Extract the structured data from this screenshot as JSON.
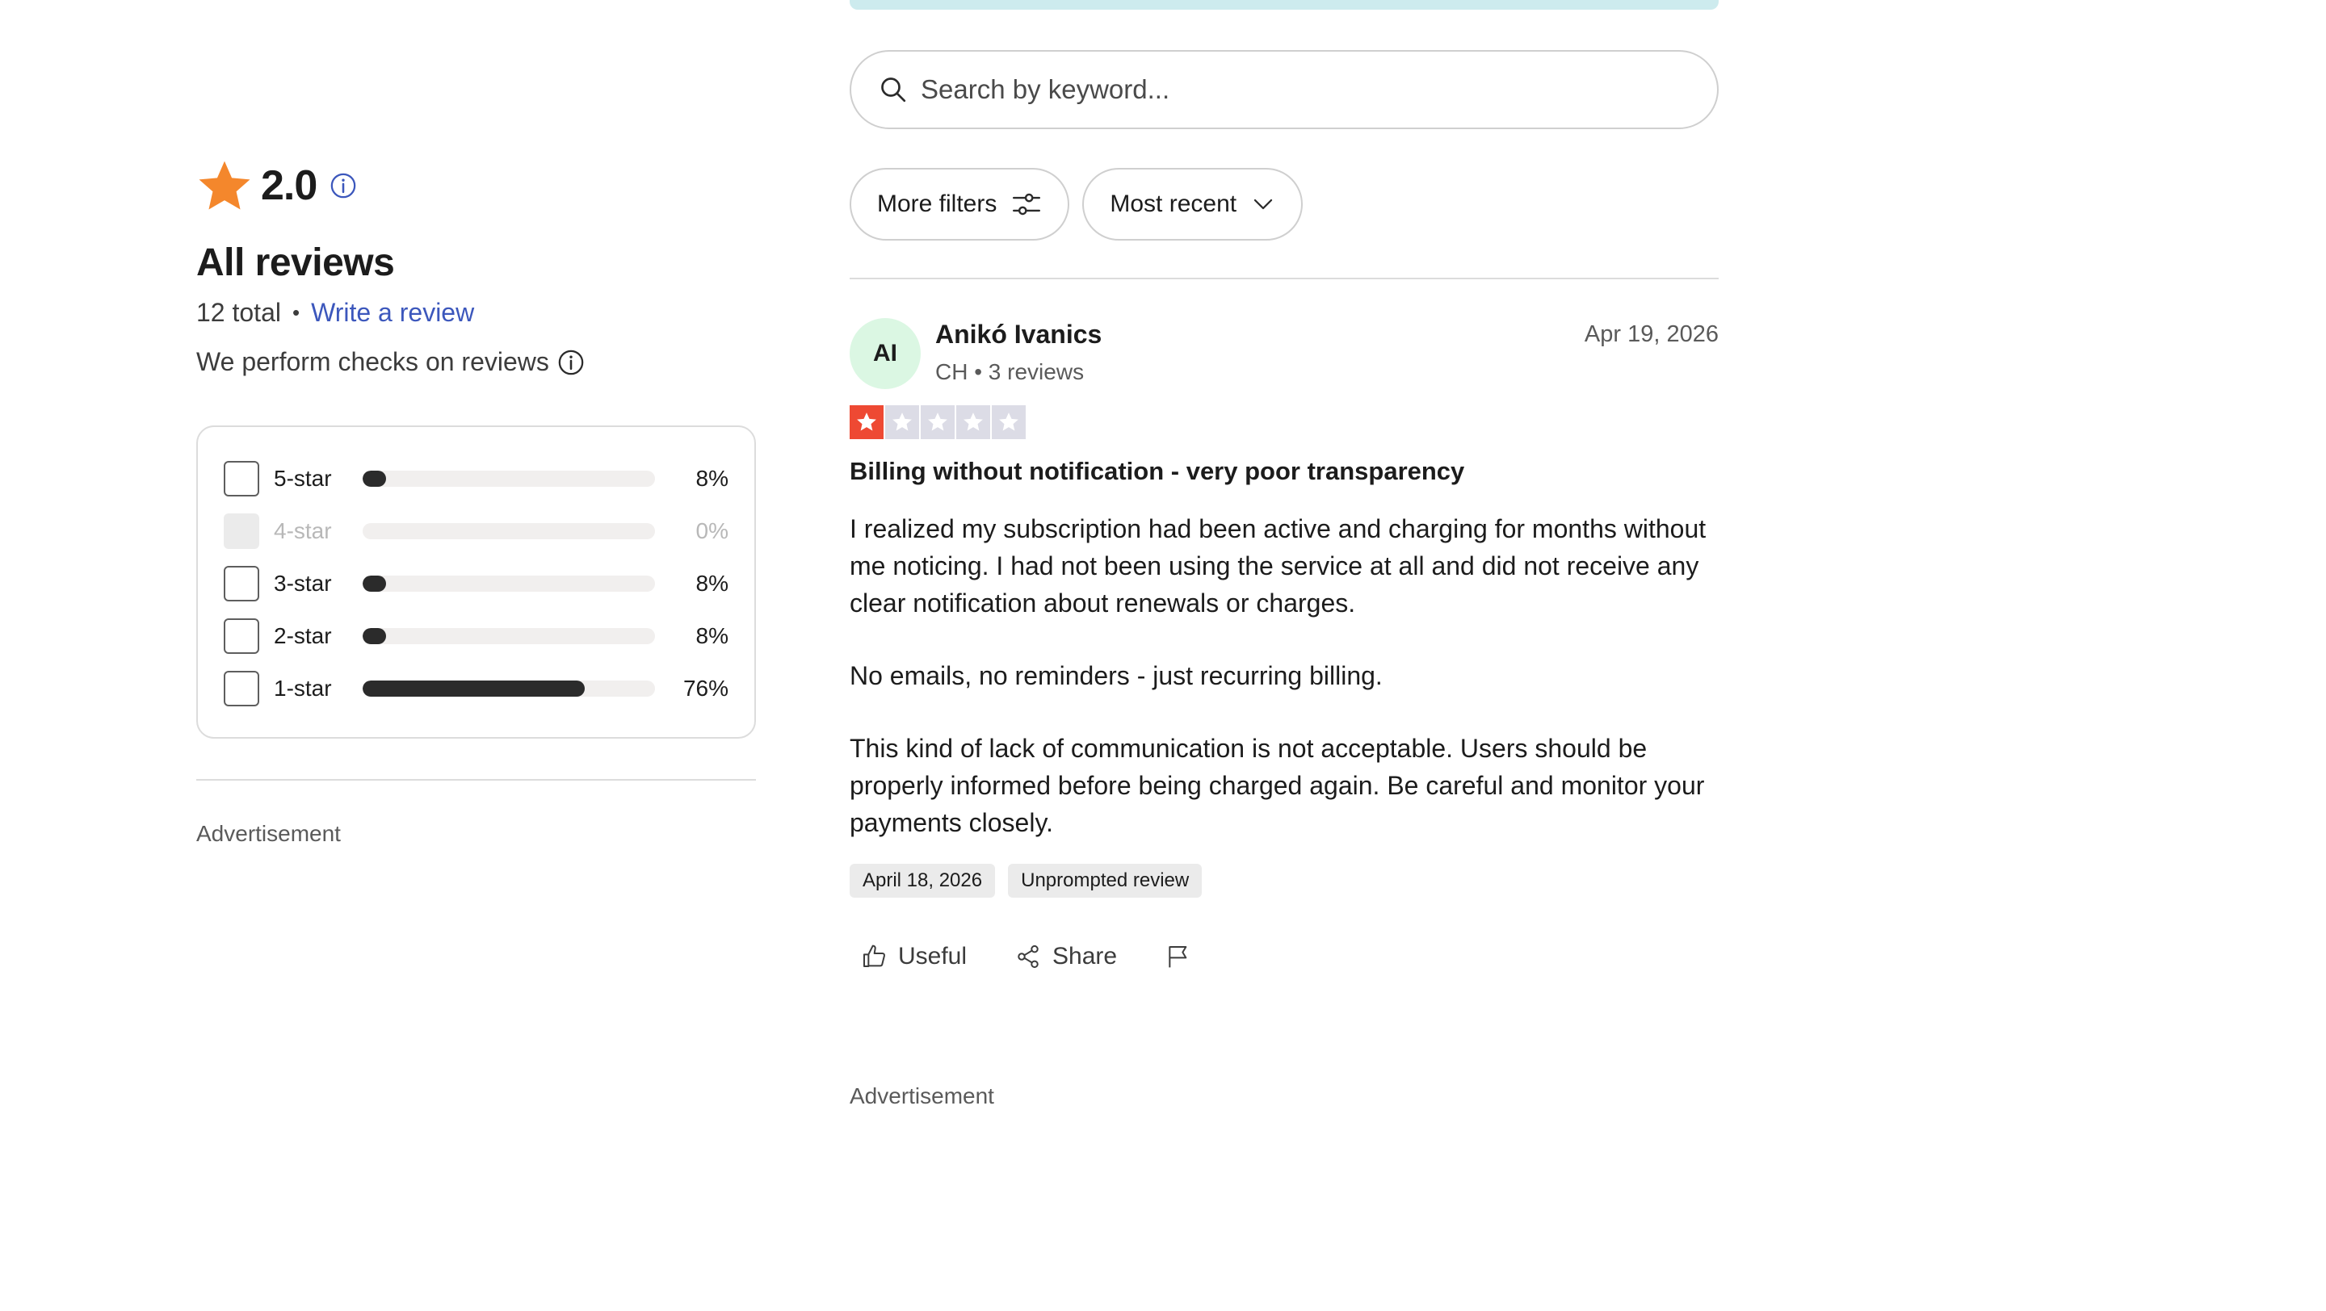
{
  "summary": {
    "rating": "2.0",
    "heading": "All reviews",
    "total": "12 total",
    "separator": "•",
    "write_review": "Write a review",
    "checks_text": "We perform checks on reviews",
    "star_color": "#f4872c",
    "info_color": "#3c57bc"
  },
  "distribution": [
    {
      "label": "5-star",
      "percent_text": "8%",
      "percent": 8,
      "disabled": false
    },
    {
      "label": "4-star",
      "percent_text": "0%",
      "percent": 0,
      "disabled": true
    },
    {
      "label": "3-star",
      "percent_text": "8%",
      "percent": 8,
      "disabled": false
    },
    {
      "label": "2-star",
      "percent_text": "8%",
      "percent": 8,
      "disabled": false
    },
    {
      "label": "1-star",
      "percent_text": "76%",
      "percent": 76,
      "disabled": false
    }
  ],
  "left_ad": "Advertisement",
  "search": {
    "placeholder": "Search by keyword...",
    "icon": "search-icon"
  },
  "filters": {
    "more_filters": "More filters",
    "sort": "Most recent"
  },
  "review": {
    "avatar_initials": "AI",
    "avatar_color": "#dbf7e3",
    "author": "Anikó Ivanics",
    "meta": "CH • 3 reviews",
    "date": "Apr 19, 2026",
    "stars": 1,
    "star_color": "#ee4933",
    "title": "Billing without notification - very poor transparency",
    "paragraphs": [
      "I realized my subscription had been active and charging for months without me noticing. I had not been using the service at all and did not receive any clear notification about renewals or charges.",
      "No emails, no reminders - just recurring billing.",
      "This kind of lack of communication is not acceptable. Users should be properly informed before being charged again. Be careful and monitor your payments closely."
    ],
    "tags": [
      "April 18, 2026",
      "Unprompted review"
    ],
    "actions": {
      "useful": "Useful",
      "share": "Share"
    }
  },
  "right_ad": "Advertisement"
}
